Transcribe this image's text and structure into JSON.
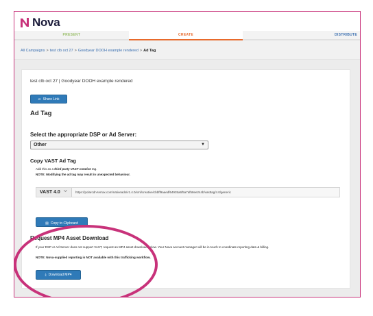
{
  "app": {
    "brand": "Nova"
  },
  "steps": [
    {
      "label": "PRESENT"
    },
    {
      "label": "CREATE"
    },
    {
      "label": "DISTRIBUTE"
    }
  ],
  "breadcrumb": {
    "items": [
      "All Campaigns",
      "test clb oct 27",
      "Goodyear DOOH example rendered"
    ],
    "separator": ">",
    "current": "Ad Tag"
  },
  "card": {
    "title": "test clb oct 27 | Goodyear DOOH example rendered",
    "share_label": "Share Link",
    "heading": "Ad Tag"
  },
  "dsp": {
    "heading": "Select the appropriate DSP or Ad Server:",
    "selected": "Other"
  },
  "vast": {
    "heading": "Copy VAST Ad Tag",
    "desc_prefix": "Add this as a ",
    "desc_emph": "third party VAST creative",
    "desc_suffix": " tag.",
    "note": "NOTE: Modifying the ad tag may result in unexpected behaviour.",
    "version": "VAST 4.0",
    "url": "https://polarcdn-terrax.com/nativeads/v1.4.0/xml/creative/cbbff9aaedf64935a6f5a7af58ee244b/vasttag/4.0/generic",
    "copy_label": "Copy to Clipboard"
  },
  "mp4": {
    "heading": "Request MP4 Asset Download",
    "desc": "If your DSP or Ad Server does not support VAST, request an MP4 asset download below. Your Nova account manager will be in touch to coordinate reporting data & billing.",
    "note": "NOTE: Nova-supplied reporting is NOT available with this trafficking workflow.",
    "button_label": "Download MP4"
  },
  "colors": {
    "accent": "#c8327a",
    "button": "#2f7ab8",
    "create": "#e86a2c"
  }
}
